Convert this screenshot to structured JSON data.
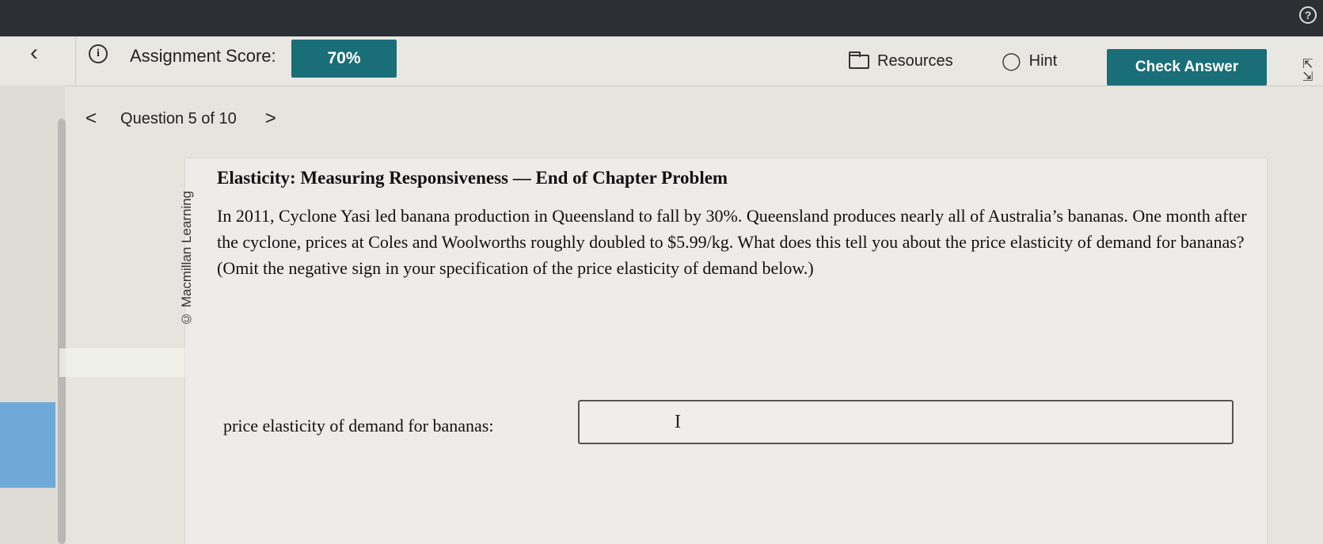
{
  "header": {
    "back_icon": "chevron-left-icon",
    "info_icon": "info-icon",
    "score_label": "Assignment Score:",
    "score_value": "70%",
    "resources_label": "Resources",
    "hint_label": "Hint",
    "check_answer_label": "Check Answer",
    "help_symbol": "?"
  },
  "question_nav": {
    "label": "Question 5 of 10",
    "prev_symbol": "<",
    "next_symbol": ">"
  },
  "question": {
    "copyright": "© Macmillan Learning",
    "title": "Elasticity: Measuring Responsiveness — End of Chapter Problem",
    "body": "In 2011, Cyclone Yasi led banana production in Queensland to fall by 30%. Queensland produces nearly all of Australia’s bananas. One month after the cyclone, prices at Coles and Woolworths roughly doubled to $5.99/kg. What does this tell you about the price elasticity of demand for bananas? (Omit the negative sign in your specification of the price elasticity of demand below.)",
    "answer_label": "price elasticity of demand for bananas:",
    "answer_value": ""
  },
  "colors": {
    "accent": "#1a6e78",
    "topbar": "#2c3034"
  }
}
